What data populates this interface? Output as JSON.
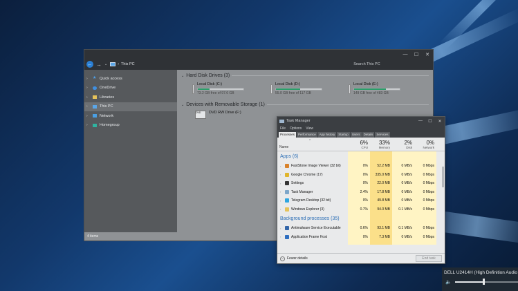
{
  "colors": {
    "accent": "#2a7fd4",
    "drive_bar": "#2c9e6a",
    "tm_section": "#2d6fb6"
  },
  "explorer": {
    "address": "This PC",
    "search_placeholder": "Search This PC",
    "window_buttons": [
      "—",
      "☐",
      "✕"
    ],
    "sidebar": [
      {
        "label": "Quick access",
        "icon": "star-icon"
      },
      {
        "label": "OneDrive",
        "icon": "cloud-icon"
      },
      {
        "label": "Libraries",
        "icon": "folder-icon"
      },
      {
        "label": "This PC",
        "icon": "computer-icon"
      },
      {
        "label": "Network",
        "icon": "network-icon"
      },
      {
        "label": "Homegroup",
        "icon": "homegroup-icon"
      }
    ],
    "hdd_header": "Hard Disk Drives (3)",
    "drives": [
      {
        "name": "Local Disk (C:)",
        "free": "73.2 GB free of 97.6 GB",
        "used_fraction": 0.25
      },
      {
        "name": "Local Disk (D:)",
        "free": "55.0 GB free of 117 GB",
        "used_fraction": 0.53
      },
      {
        "name": "Local Disk (E:)",
        "free": "149 GB free of 483 GB",
        "used_fraction": 0.69
      }
    ],
    "removable_header": "Devices with Removable Storage (1)",
    "dvd": {
      "name": "DVD RW Drive (F:)",
      "badge": "DVD"
    },
    "status": "4 items"
  },
  "taskmanager": {
    "title": "Task Manager",
    "menu": [
      "File",
      "Options",
      "View"
    ],
    "tabs": [
      "Processes",
      "Performance",
      "App history",
      "Startup",
      "Users",
      "Details",
      "Services"
    ],
    "columns": {
      "name": "Name",
      "cpu_pct": "6%",
      "cpu": "CPU",
      "mem_pct": "33%",
      "mem": "Memory",
      "disk_pct": "2%",
      "disk": "Disk",
      "net_pct": "0%",
      "net": "Network"
    },
    "apps_header": "Apps (6)",
    "apps": [
      {
        "name": "FastStone Image Viewer (32 bit)",
        "icon": "faststone-icon",
        "cpu": "0%",
        "mem": "52.2 MB",
        "disk": "0 MB/s",
        "net": "0 Mbps"
      },
      {
        "name": "Google Chrome (17)",
        "icon": "chrome-icon",
        "cpu": "0%",
        "mem": "335.0 MB",
        "disk": "0 MB/s",
        "net": "0 Mbps"
      },
      {
        "name": "Settings",
        "icon": "settings-icon",
        "cpu": "0%",
        "mem": "22.0 MB",
        "disk": "0 MB/s",
        "net": "0 Mbps"
      },
      {
        "name": "Task Manager",
        "icon": "taskmanager-icon",
        "cpu": "2.4%",
        "mem": "17.8 MB",
        "disk": "0 MB/s",
        "net": "0 Mbps"
      },
      {
        "name": "Telegram Desktop (32 bit)",
        "icon": "telegram-icon",
        "cpu": "0%",
        "mem": "49.8 MB",
        "disk": "0 MB/s",
        "net": "0 Mbps"
      },
      {
        "name": "Windows Explorer (3)",
        "icon": "explorer-icon",
        "cpu": "0.7%",
        "mem": "94.0 MB",
        "disk": "0.1 MB/s",
        "net": "0 Mbps"
      }
    ],
    "bg_header": "Background processes (35)",
    "bg": [
      {
        "name": "Antimalware Service Executable",
        "icon": "shield-icon",
        "cpu": "0.6%",
        "mem": "93.1 MB",
        "disk": "0.1 MB/s",
        "net": "0 Mbps"
      },
      {
        "name": "Application Frame Host",
        "icon": "appframe-icon",
        "cpu": "0%",
        "mem": "7.3 MB",
        "disk": "0 MB/s",
        "net": "0 Mbps"
      }
    ],
    "fewer_details": "Fewer details",
    "end_task": "End task"
  },
  "audio": {
    "device": "DELL U2414H (High Definition Audio D",
    "volume_fraction": 0.45
  }
}
